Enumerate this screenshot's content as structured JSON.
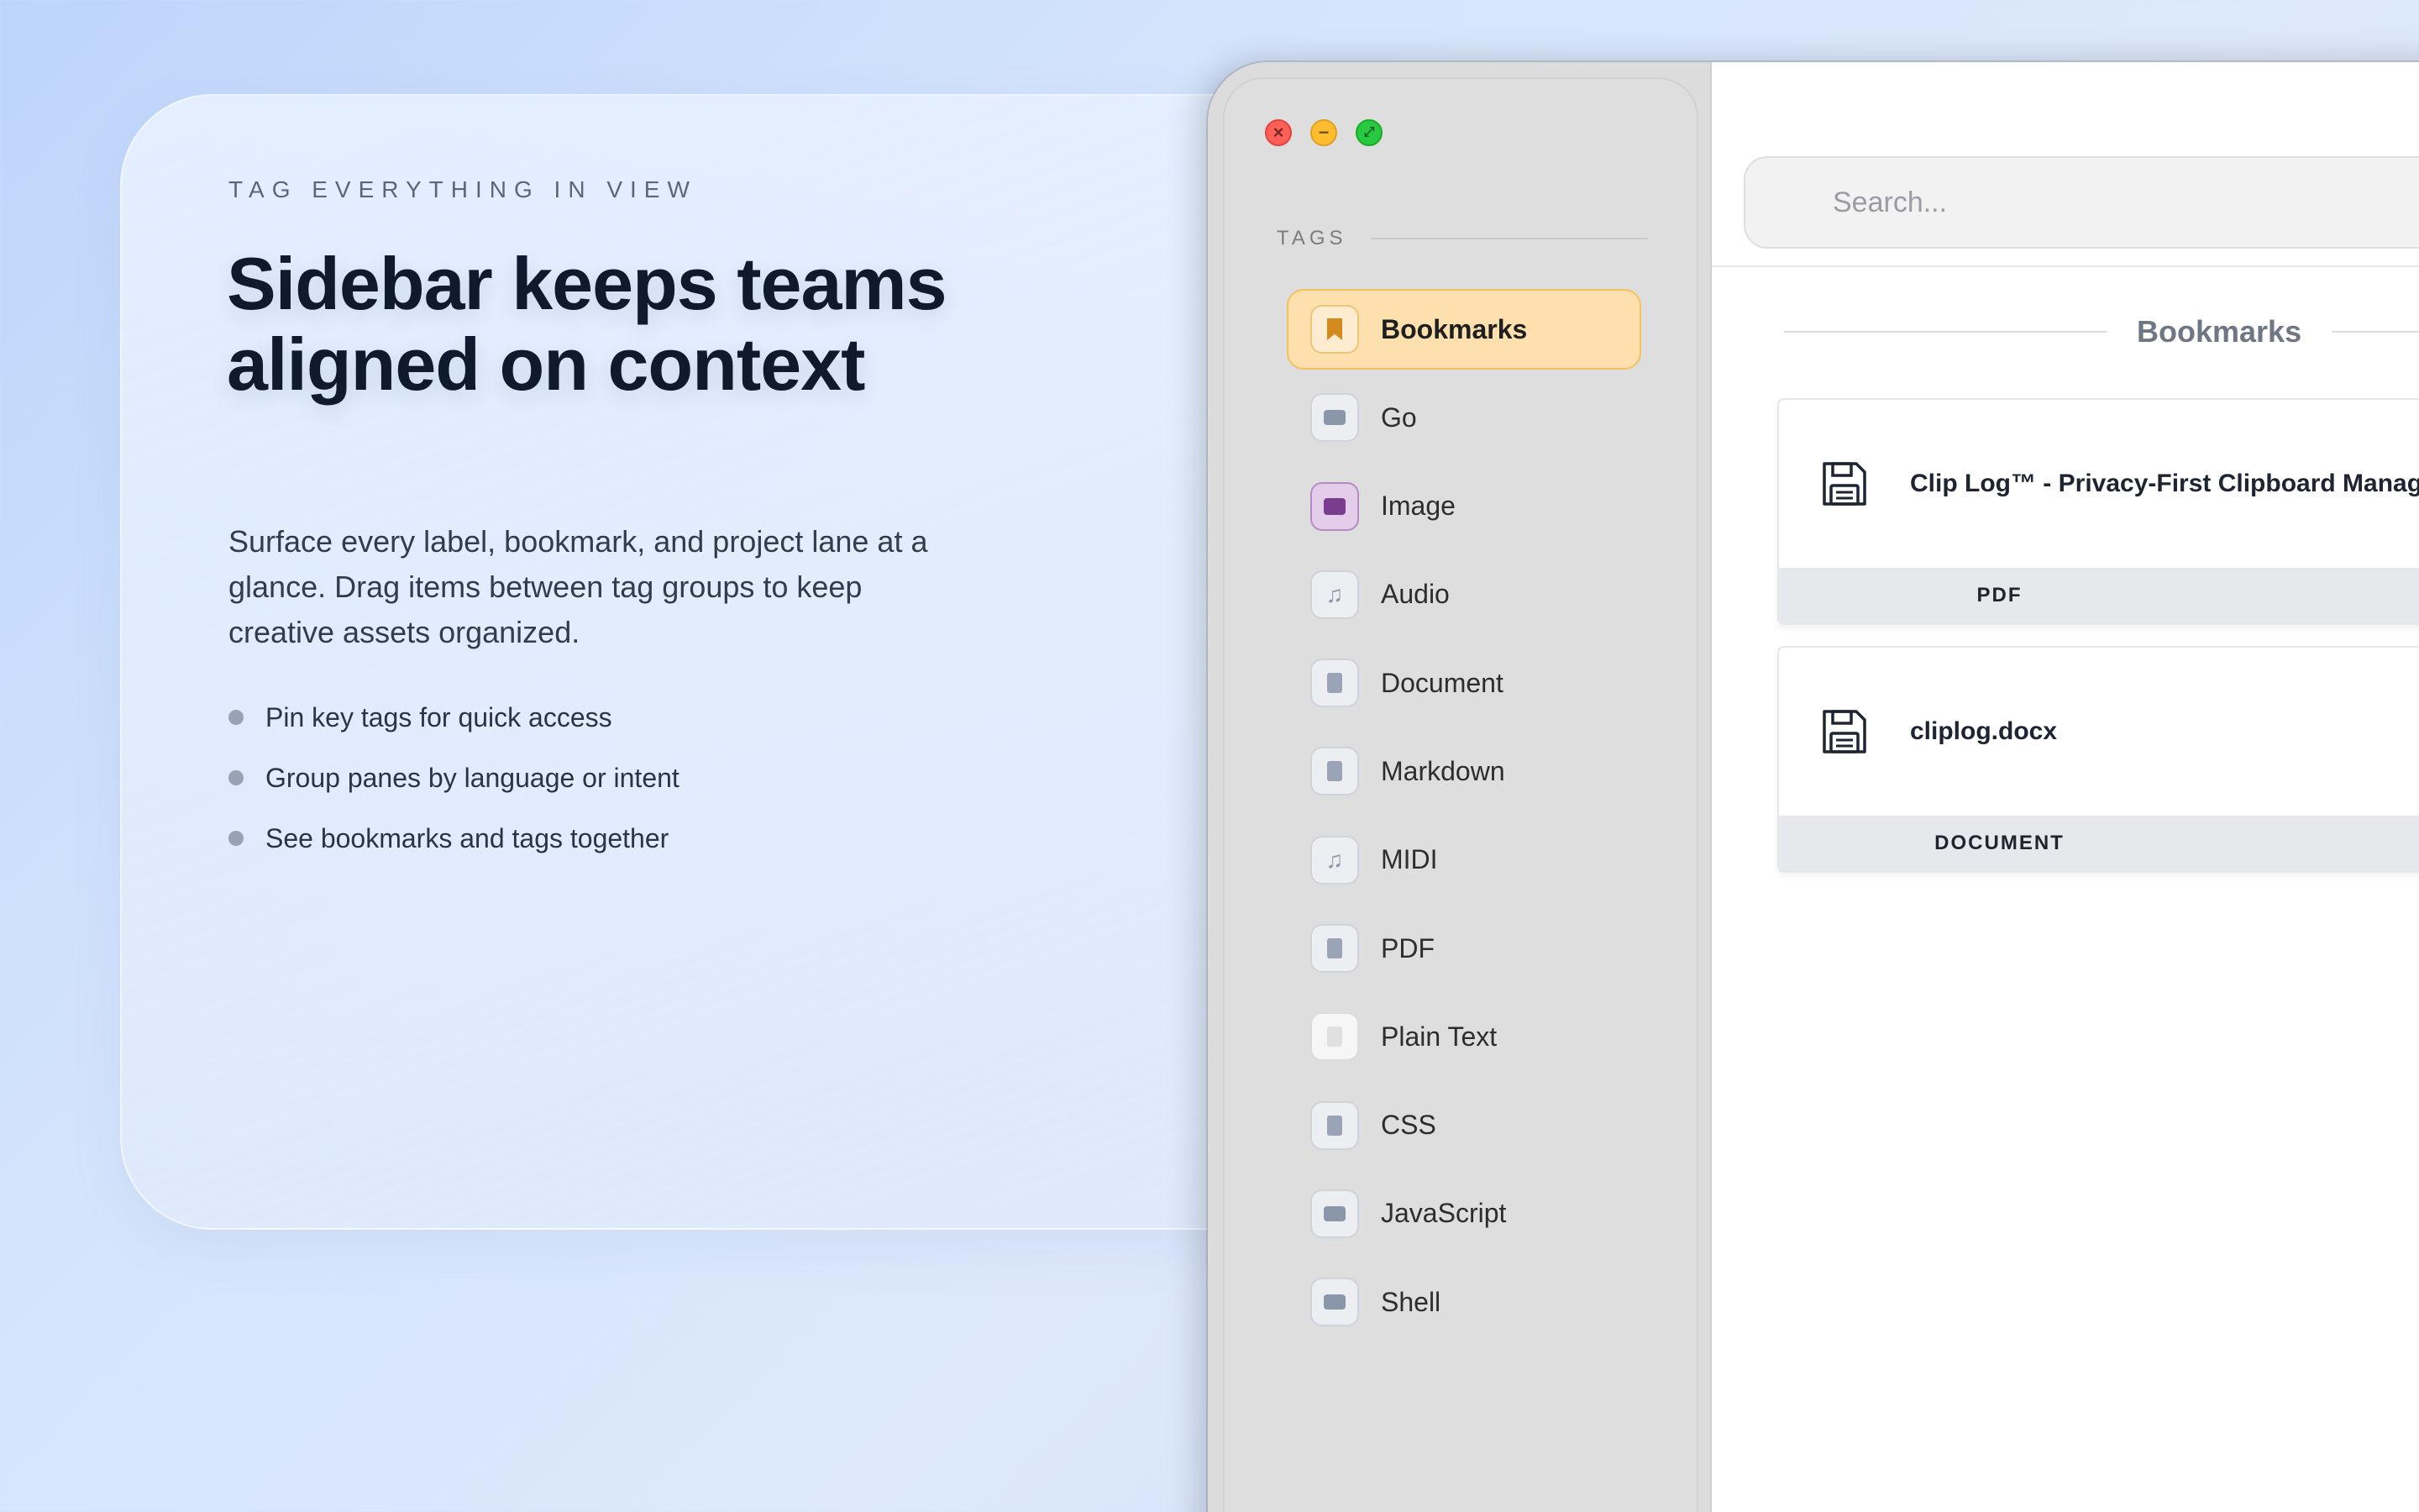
{
  "promo": {
    "eyebrow": "TAG EVERYTHING IN VIEW",
    "headline": "Sidebar keeps teams aligned on context",
    "description": "Surface every label, bookmark, and project lane at a glance. Drag items between tag groups to keep creative assets organized.",
    "bullets": [
      "Pin key tags for quick access",
      "Group panes by language or intent",
      "See bookmarks and tags together"
    ]
  },
  "window": {
    "traffic_lights": {
      "close": "×",
      "minimize": "−",
      "zoom": "⤢"
    },
    "sidebar": {
      "section_label": "TAGS",
      "items": [
        {
          "label": "Bookmarks",
          "icon": "bookmark-icon",
          "active": true
        },
        {
          "label": "Go",
          "icon": "terminal-icon"
        },
        {
          "label": "Image",
          "icon": "image-icon"
        },
        {
          "label": "Audio",
          "icon": "music-note-icon"
        },
        {
          "label": "Document",
          "icon": "document-icon"
        },
        {
          "label": "Markdown",
          "icon": "document-icon"
        },
        {
          "label": "MIDI",
          "icon": "music-note-icon"
        },
        {
          "label": "PDF",
          "icon": "document-icon"
        },
        {
          "label": "Plain Text",
          "icon": "document-icon"
        },
        {
          "label": "CSS",
          "icon": "code-file-icon"
        },
        {
          "label": "JavaScript",
          "icon": "terminal-icon"
        },
        {
          "label": "Shell",
          "icon": "terminal-icon"
        }
      ]
    },
    "search": {
      "placeholder": "Search..."
    },
    "section_title": "Bookmarks",
    "cards": [
      {
        "title": "Clip Log™ - Privacy-First Clipboard Manager",
        "type": "PDF",
        "icon": "floppy-disk-icon"
      },
      {
        "title": "cliplog.docx",
        "type": "DOCUMENT",
        "icon": "floppy-disk-icon"
      }
    ]
  }
}
